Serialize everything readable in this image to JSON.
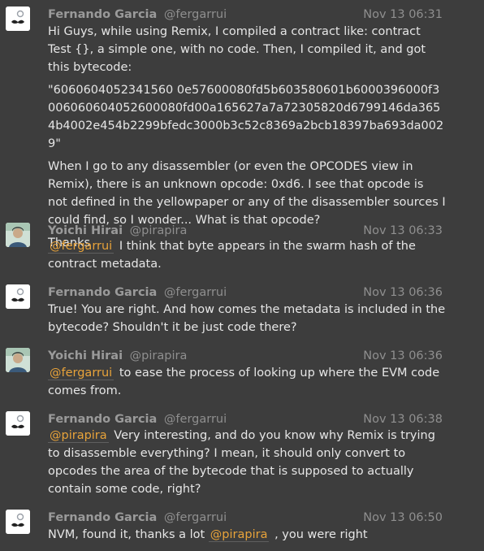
{
  "messages": [
    {
      "author": "Fernando Garcia",
      "handle": "@fergarrui",
      "time": "Nov 13 06:31",
      "avatar_icon": "mustache-avatar-icon",
      "paragraphs": [
        "Hi Guys, while using Remix, I compiled a contract like: contract Test {}, a simple one, with no code. Then, I compiled it, and got this bytecode:",
        "\"6060604052341560 0e57600080fd5b603580601b6000396000f3006060604052600080fd00a165627a7a72305820d6799146da3654b4002e454b2299bfedc3000b3c52c8369a2bcb18397ba693da0029\"",
        "When I go to any disassembler (or even the OPCODES view in Remix), there is an unknown opcode: 0xd6. I see that opcode is not defined in the yellowpaper or any of the disassembler sources I could find, so I wonder... What is that opcode?",
        "Thanks"
      ]
    },
    {
      "author": "Yoichi Hirai",
      "handle": "@pirapira",
      "time": "Nov 13 06:33",
      "avatar_icon": "profile-photo-avatar-icon",
      "mention": "@fergarrui",
      "text": " I think that byte appears in the swarm hash of the contract metadata."
    },
    {
      "author": "Fernando Garcia",
      "handle": "@fergarrui",
      "time": "Nov 13 06:36",
      "avatar_icon": "mustache-avatar-icon",
      "text": "True! You are right. And how comes the metadata is included in the bytecode? Shouldn't it be just code there?"
    },
    {
      "author": "Yoichi Hirai",
      "handle": "@pirapira",
      "time": "Nov 13 06:36",
      "avatar_icon": "profile-photo-avatar-icon",
      "mention": "@fergarrui",
      "text": " to ease the process of looking up where the EVM code comes from."
    },
    {
      "author": "Fernando Garcia",
      "handle": "@fergarrui",
      "time": "Nov 13 06:38",
      "avatar_icon": "mustache-avatar-icon",
      "mention": "@pirapira",
      "text": " Very interesting, and do you know why Remix is trying to disassemble everything? I mean, it should only convert to opcodes the area of the bytecode that is supposed to actually contain some code, right?"
    },
    {
      "author": "Fernando Garcia",
      "handle": "@fergarrui",
      "time": "Nov 13 06:50",
      "avatar_icon": "mustache-avatar-icon",
      "text_before": "NVM, found it, thanks a lot ",
      "mention": "@pirapira",
      "text_after": " , you were right"
    }
  ]
}
